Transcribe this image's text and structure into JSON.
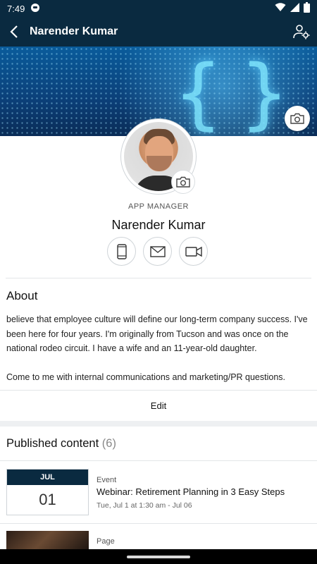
{
  "status_bar": {
    "time": "7:49",
    "icons": [
      "app-notification-icon",
      "wifi-icon",
      "signal-icon",
      "battery-icon"
    ]
  },
  "app_bar": {
    "title": "Narender Kumar",
    "back_icon": "back-arrow-icon",
    "settings_icon": "user-settings-icon"
  },
  "profile": {
    "role": "APP MANAGER",
    "name": "Narender Kumar",
    "contact_icons": [
      "phone-icon",
      "mail-icon",
      "video-icon"
    ]
  },
  "about": {
    "title": "About",
    "paragraph1": "believe that employee culture will define our long-term company success. I've been here for four years. I'm originally from Tucson and was once on the national rodeo circuit. I have a wife and an 11-year-old daughter.",
    "paragraph2": "Come to me with internal communications and marketing/PR questions."
  },
  "edit_label": "Edit",
  "published": {
    "title": "Published content",
    "count": "(6)",
    "items": [
      {
        "month": "JUL",
        "day": "01",
        "type": "Event",
        "title": "Webinar: Retirement Planning in 3 Easy Steps",
        "date": "Tue, Jul 1 at 1:30 am - Jul 06"
      },
      {
        "type": "Page"
      }
    ]
  },
  "colors": {
    "primary": "#0a2a40",
    "divider": "#e3e6e8",
    "section_gap": "#eef0f2"
  }
}
